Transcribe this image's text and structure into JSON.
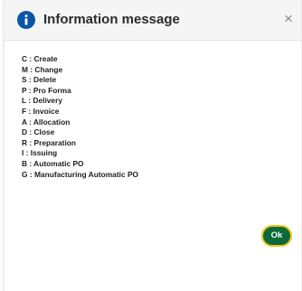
{
  "dialog": {
    "title": "Information message",
    "icon": "info-icon",
    "close_label": "×",
    "ok_label": "Ok",
    "colors": {
      "icon": "#0a55a6",
      "ok_button": "#0b6a3a",
      "ok_border": "#f0c419"
    }
  },
  "codes": [
    "C : Create",
    "M : Change",
    "S : Delete",
    "P : Pro Forma",
    "L : Delivery",
    "F : Invoice",
    "A : Allocation",
    "D : Close",
    "R : Preparation",
    "I : Issuing",
    "B : Automatic PO",
    "G : Manufacturing Automatic PO"
  ]
}
